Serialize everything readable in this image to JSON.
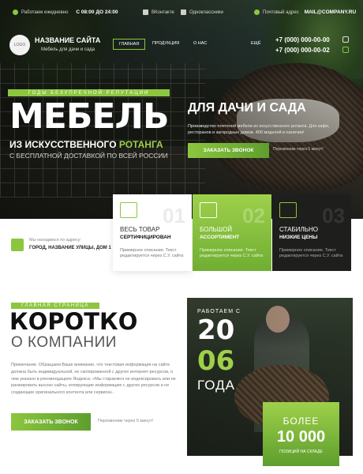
{
  "topbar": {
    "hours_label": "Работаем ежедневно",
    "hours_value": "С 08:00 ДО 24:00",
    "link1": "ВКонтакте",
    "link2": "Одноклассники",
    "email_label": "Почтовый адрес",
    "email_value": "MAIL@COMPANY.RU"
  },
  "header": {
    "logo_text": "LOGO",
    "site_name": "НАЗВАНИЕ САЙТА",
    "site_sub": "Мебель для дачи и сада",
    "nav": [
      "ГЛАВНАЯ",
      "ПРОДУКЦИЯ",
      "О НАС",
      "ЕЩЁ"
    ],
    "phone1": "+7 (000) 000-00-00",
    "phone2": "+7 (000) 000-00-02"
  },
  "hero": {
    "years_label": "ГОДЫ БЕЗУПРЕЧНОЙ РЕПУТАЦИИ",
    "title_big": "МЕБЕЛЬ",
    "title_line2_a": "ИЗ ИСКУССТВЕННОГО",
    "title_line2_b": "РОТАНГА",
    "delivery": "С БЕСПЛАТНОЙ ДОСТАВКОЙ ПО ВСЕЙ РОССИИ",
    "right_title": "ДЛЯ ДАЧИ И САДА",
    "right_desc": "Производство плетеной мебели из искусственного ротанга. Для кафе, ресторанов и загородных домов. 400 моделей в наличии!",
    "button": "ЗАКАЗАТЬ ЗВОНОК",
    "callback_note": "Перезвоним через 5 минут!"
  },
  "address": {
    "label": "Мы находимся по адресу:",
    "value": "ГОРОД, НАЗВАНИЕ УЛИЦЫ, ДОМ 1"
  },
  "cards": [
    {
      "num": "01",
      "line1": "ВЕСЬ ТОВАР",
      "line2": "СЕРТИФИЦИРОВАН",
      "desc": "Примерное описание. Текст редактируется через С.У. сайта",
      "icon": "certificate-icon"
    },
    {
      "num": "02",
      "line1": "БОЛЬШОЙ",
      "line2": "АССОРТИМЕНТ",
      "desc": "Примерное описание. Текст редактируется через С.У. сайта",
      "icon": "warehouse-icon"
    },
    {
      "num": "03",
      "line1": "СТАБИЛЬНО",
      "line2": "НИЗКИЕ ЦЕНЫ",
      "desc": "Примерное описание. Текст редактируется через С.У. сайта",
      "icon": "coins-icon"
    }
  ],
  "about": {
    "section_label": "ГЛАВНАЯ СТРАНИЦА",
    "title": "КОРОТКО",
    "subtitle": "О КОМПАНИИ",
    "paragraph": "Примечание. Обращаем Ваше внимание, что текстовая информация на сайте должна быть индивидуальной, не скопированной с других интернет-ресурсов, о чем указано в рекомендациях Яндекса: «Мы стараемся не индексировать или не ранжировать высоко сайты, копирующие информацию с других ресурсов и не создающие оригинального контента или сервиса».",
    "button": "ЗАКАЗАТЬ ЗВОНОК",
    "callback_note": "Перезвоним через 5 минут!"
  },
  "stats": {
    "working_label": "РАБОТАЕМ С",
    "year_a": "20",
    "year_b": "06",
    "year_word": "ГОДА",
    "more_label": "БОЛЕЕ",
    "more_value": "10 000",
    "more_sub": "ПОЗИЦИЙ НА СКЛАДЕ"
  },
  "colors": {
    "accent": "#8cc63f",
    "accent_dark": "#5e9e2d"
  }
}
